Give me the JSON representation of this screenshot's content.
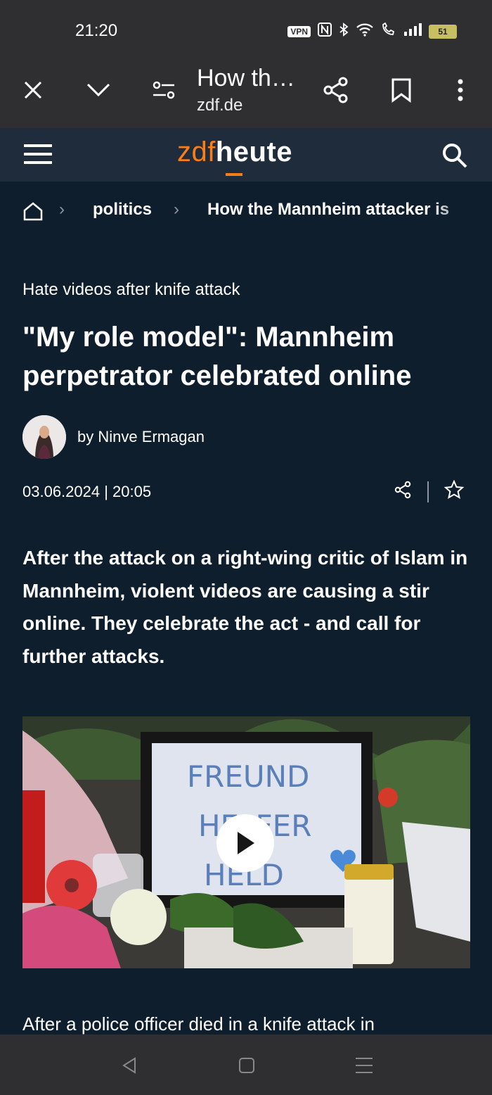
{
  "status_bar": {
    "time": "21:20",
    "vpn": "VPN",
    "battery": "51",
    "icons": [
      "nfc-icon",
      "bluetooth-icon",
      "wifi-icon",
      "wifi-calling-icon",
      "signal-icon",
      "battery-icon"
    ]
  },
  "browser_bar": {
    "tab_title": "How th…",
    "domain": "zdf.de",
    "icons": [
      "close-icon",
      "chevron-down-icon",
      "page-settings-icon",
      "share-icon",
      "bookmark-icon",
      "more-icon"
    ]
  },
  "site_header": {
    "logo_part1": "zdf",
    "logo_part2": "heute",
    "accent": "#fa7d19",
    "icons": [
      "menu-icon",
      "search-icon"
    ]
  },
  "breadcrumb": {
    "items": [
      "politics",
      "How the Mannheim attacker is"
    ]
  },
  "article": {
    "kicker": "Hate videos after knife attack",
    "headline": "\"My role model\": Mannheim perpetrator celebrated online",
    "author": "by Ninve Ermagan",
    "date": "03.06.2024 | 20:05",
    "lead": "After the attack on a right-wing critic of Islam in Mannheim, violent videos are causing a stir online. They celebrate the act - and call for further attacks.",
    "image_sign_text": "FREUND HELFER HELD",
    "body_start": "After a police officer died in a knife attack in"
  },
  "colors": {
    "page_bg": "#0f1e2d",
    "nav_bg": "#1e2c3b",
    "system_bar_bg": "#2f2f31"
  }
}
